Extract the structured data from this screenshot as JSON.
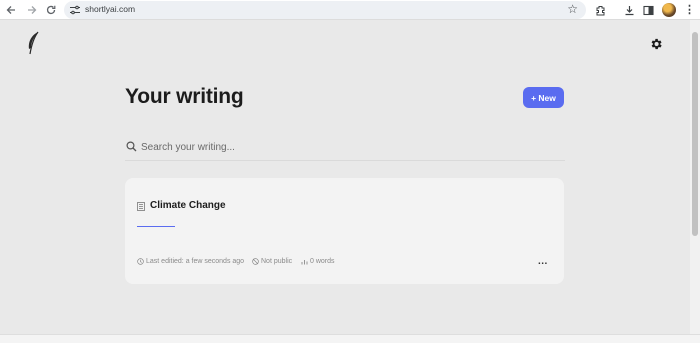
{
  "browser": {
    "url": "shortlyai.com",
    "icons": [
      "back-icon",
      "forward-icon",
      "reload-icon",
      "site-settings-icon",
      "bookmark-star-icon",
      "extensions-icon",
      "download-icon",
      "side-panel-icon",
      "profile-avatar",
      "menu-icon"
    ]
  },
  "app": {
    "logo": "feather-icon",
    "settings_icon": "gear-icon",
    "title": "Your writing",
    "new_button_label": "+ New",
    "search_placeholder": "Search your writing...",
    "accent_color": "#5a6cf0"
  },
  "documents": [
    {
      "title": "Climate Change",
      "last_edited": "Last editied: a few seconds ago",
      "visibility": "Not public",
      "words": "0 words",
      "more_label": "..."
    }
  ]
}
